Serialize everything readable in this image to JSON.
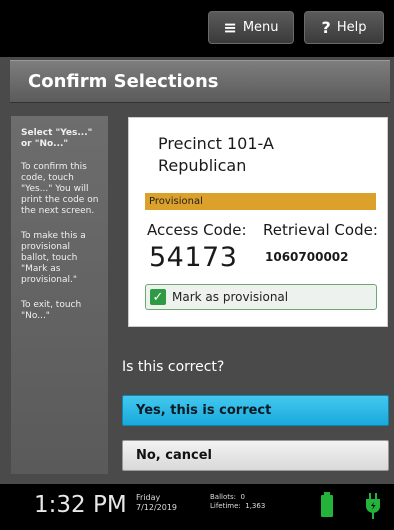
{
  "topbar": {
    "menu_label": "Menu",
    "help_label": "Help"
  },
  "title": "Confirm Selections",
  "sidebar": {
    "heading": "Select \"Yes...\" or \"No...\"",
    "para1": "To confirm this code, touch \"Yes...\" You will print the code on the next screen.",
    "para2": "To make this a provisional ballot, touch \"Mark as provisional.\"",
    "para3": "To exit, touch \"No...\""
  },
  "card": {
    "precinct": "Precinct 101-A",
    "party": "Republican",
    "ribbon": "Provisional",
    "access_label": "Access Code:",
    "access_value": "54173",
    "retrieval_label": "Retrieval Code:",
    "retrieval_value": "1060700002",
    "mark_label": "Mark as provisional",
    "mark_checked": true
  },
  "question": "Is this correct?",
  "buttons": {
    "yes": "Yes, this is correct",
    "no": "No, cancel"
  },
  "status": {
    "time": "1:32 PM",
    "day": "Friday",
    "date": "7/12/2019",
    "ballots_label": "Ballots:",
    "ballots_value": "0",
    "lifetime_label": "Lifetime:",
    "lifetime_value": "1,363"
  },
  "colors": {
    "accent": "#19a9db",
    "ribbon": "#dca12a",
    "check": "#2e9a44",
    "battery": "#23b33b"
  }
}
